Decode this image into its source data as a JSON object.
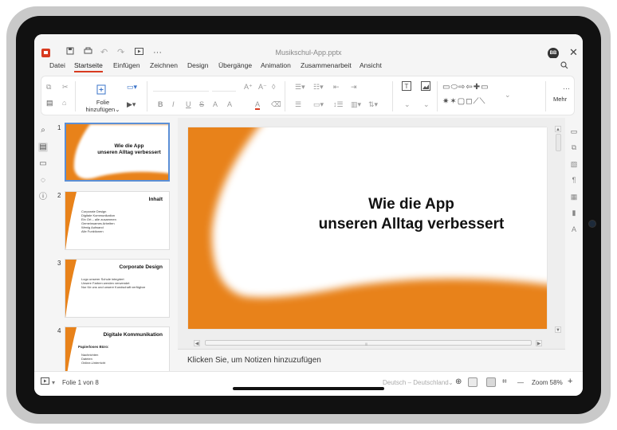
{
  "app": {
    "document_title": "Musikschul-App.pptx",
    "user_initials": "BB",
    "close_glyph": "✕"
  },
  "quick_access": {
    "save_icon": "save-icon",
    "print_icon": "print-icon",
    "undo_icon": "undo-icon",
    "redo_icon": "redo-icon",
    "present_icon": "present-icon",
    "more_glyph": "···"
  },
  "menu": {
    "items": [
      "Datei",
      "Startseite",
      "Einfügen",
      "Zeichnen",
      "Design",
      "Übergänge",
      "Animation",
      "Zusammenarbeit",
      "Ansicht"
    ],
    "active": "Startseite"
  },
  "ribbon": {
    "new_slide_line1": "Folie",
    "new_slide_line2": "hinzufügen",
    "dropdown_glyph": "⌄",
    "more_glyph": "···",
    "more_label": "Mehr",
    "format_letters": [
      "B",
      "I",
      "U",
      "S",
      "A",
      "A",
      "A"
    ]
  },
  "slides": [
    {
      "number": "1",
      "title_line1": "Wie die App",
      "title_line2": "unseren Alltag verbessert",
      "selected": true
    },
    {
      "number": "2",
      "title": "Inhalt",
      "bullets": [
        "Corporate Design",
        "Digitale Kommunikation",
        "Ein Ort – alle zusammen",
        "Gemeinsames Arbeiten",
        "Wenig Aufwand",
        "Alle Funktionen"
      ]
    },
    {
      "number": "3",
      "title": "Corporate Design",
      "bullets": [
        "Logo unserer Schule integriert",
        "Unsere Farben werden verwendet",
        "Nur für uns und unsere Kundschaft verfügbar"
      ]
    },
    {
      "number": "4",
      "title": "Digitale Kommunikation",
      "subtitle": "Papierloses Büro:",
      "bullets": [
        "Nachrichten",
        "Dateien",
        "Online-Unterricht"
      ]
    }
  ],
  "main_slide": {
    "title_line1": "Wie die App",
    "title_line2": "unseren Alltag verbessert",
    "accent_color": "#e8821a"
  },
  "notes": {
    "placeholder": "Klicken Sie, um Notizen hinzuzufügen"
  },
  "status": {
    "slide_counter": "Folie 1 von 8",
    "language": "Deutsch – Deutschland",
    "zoom_label": "Zoom 58%",
    "zoom_minus": "—",
    "zoom_plus": "+"
  },
  "colors": {
    "brand": "#d83b20",
    "selection": "#5b8fd6",
    "slide_accent": "#e8821a"
  }
}
